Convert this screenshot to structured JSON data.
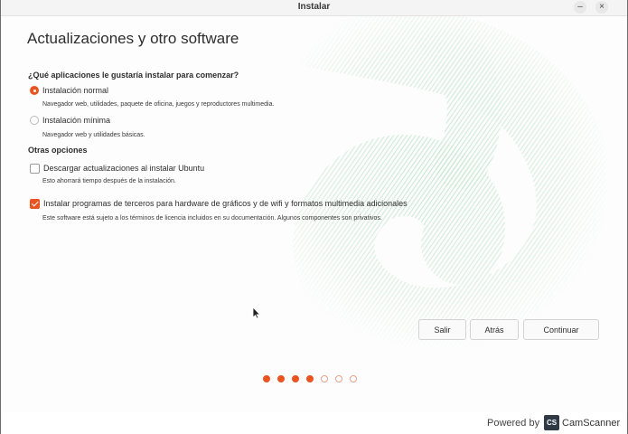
{
  "window": {
    "title": "Instalar",
    "minimize_glyph": "–",
    "close_glyph": "×"
  },
  "page": {
    "title": "Actualizaciones y otro software",
    "question": "¿Qué aplicaciones le gustaría instalar para comenzar?"
  },
  "install_options": [
    {
      "label": "Instalación normal",
      "description": "Navegador web, utilidades, paquete de oficina, juegos y reproductores multimedia.",
      "selected": true
    },
    {
      "label": "Instalación mínima",
      "description": "Navegador web y utilidades básicas.",
      "selected": false
    }
  ],
  "other_options": {
    "heading": "Otras opciones",
    "items": [
      {
        "label": "Descargar actualizaciones al instalar Ubuntu",
        "description": "Esto ahorrará tiempo después de la instalación.",
        "checked": false
      },
      {
        "label": "Instalar programas de terceros para hardware de gráficos y de wifi y formatos multimedia adicionales",
        "description": "Este software está sujeto a los términos de licencia incluidos en su documentación. Algunos componentes son privativos.",
        "checked": true
      }
    ]
  },
  "buttons": {
    "quit": "Salir",
    "back": "Atrás",
    "continue": "Continuar"
  },
  "progress": {
    "current_step": 4,
    "total_steps": 7
  },
  "footer": {
    "powered_by": "Powered by",
    "brand_logo": "CS",
    "brand_name": "CamScanner"
  },
  "colors": {
    "accent": "#e95420"
  }
}
